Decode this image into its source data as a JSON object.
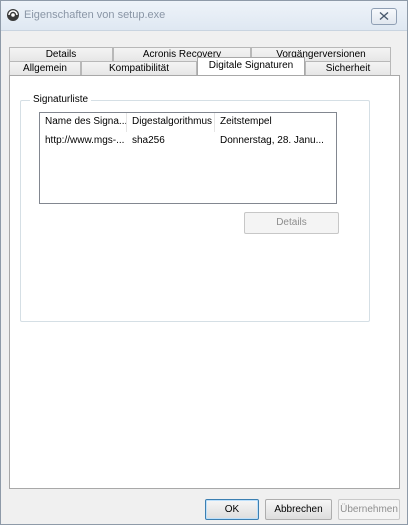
{
  "window": {
    "title": "Eigenschaften von setup.exe",
    "icons": {
      "app": "program-icon",
      "close": "close-icon"
    }
  },
  "tabs": {
    "row1": [
      "Details",
      "Acronis Recovery",
      "Vorgängerversionen"
    ],
    "row2": [
      "Allgemein",
      "Kompatibilität",
      "Digitale Signaturen",
      "Sicherheit"
    ],
    "active": "Digitale Signaturen"
  },
  "signatures": {
    "group_label": "Signaturliste",
    "columns": [
      "Name des Signa...",
      "Digestalgorithmus",
      "Zeitstempel"
    ],
    "rows": [
      [
        "http://www.mgs-...",
        "sha256",
        "Donnerstag, 28. Janu..."
      ]
    ],
    "details_button": "Details"
  },
  "footer": {
    "ok": "OK",
    "cancel": "Abbrechen",
    "apply": "Übernehmen"
  }
}
